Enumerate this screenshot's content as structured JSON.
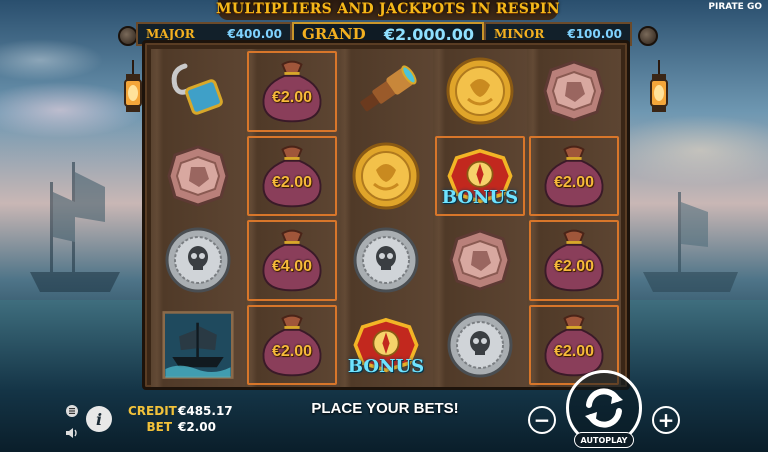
{
  "brand": "PIRATE GO",
  "header": {
    "title": "MULTIPLIERS AND JACKPOTS IN RESPIN",
    "jackpots": [
      {
        "label": "MAJOR",
        "value": "€400.00"
      },
      {
        "label": "GRAND",
        "value": "€2,000.00"
      },
      {
        "label": "MINOR",
        "value": "€100.00"
      }
    ]
  },
  "reels": {
    "cells": [
      {
        "symbol": "hook",
        "text": "",
        "highlight": false
      },
      {
        "symbol": "money-bag",
        "text": "€2.00",
        "highlight": true
      },
      {
        "symbol": "spyglass",
        "text": "",
        "highlight": false
      },
      {
        "symbol": "gold-coin",
        "text": "",
        "highlight": false
      },
      {
        "symbol": "copper-coin",
        "text": "",
        "highlight": false
      },
      {
        "symbol": "copper-coin",
        "text": "",
        "highlight": false
      },
      {
        "symbol": "money-bag",
        "text": "€2.00",
        "highlight": true
      },
      {
        "symbol": "gold-coin",
        "text": "",
        "highlight": false
      },
      {
        "symbol": "bonus-compass",
        "text": "BONUS",
        "highlight": true
      },
      {
        "symbol": "money-bag",
        "text": "€2.00",
        "highlight": true
      },
      {
        "symbol": "silver-coin",
        "text": "",
        "highlight": false
      },
      {
        "symbol": "money-bag",
        "text": "€4.00",
        "highlight": true
      },
      {
        "symbol": "silver-coin",
        "text": "",
        "highlight": false
      },
      {
        "symbol": "copper-coin",
        "text": "",
        "highlight": false
      },
      {
        "symbol": "money-bag",
        "text": "€2.00",
        "highlight": true
      },
      {
        "symbol": "ship-card",
        "text": "",
        "highlight": false
      },
      {
        "symbol": "money-bag",
        "text": "€2.00",
        "highlight": true
      },
      {
        "symbol": "bonus-compass",
        "text": "BONUS",
        "highlight": false
      },
      {
        "symbol": "silver-coin",
        "text": "",
        "highlight": false
      },
      {
        "symbol": "money-bag",
        "text": "€2.00",
        "highlight": true
      }
    ]
  },
  "footer": {
    "credit_label": "CREDIT",
    "credit_value": "€485.17",
    "bet_label": "BET",
    "bet_value": "€2.00",
    "message": "PLACE YOUR BETS!",
    "autoplay_label": "AUTOPLAY",
    "minus_label": "−",
    "plus_label": "+",
    "info_label": "i"
  },
  "colors": {
    "jackpot_label": "#f3b020",
    "jackpot_value": "#7fd3ff",
    "highlight_border": "#d8762a",
    "credit_label": "#f2c23a"
  }
}
